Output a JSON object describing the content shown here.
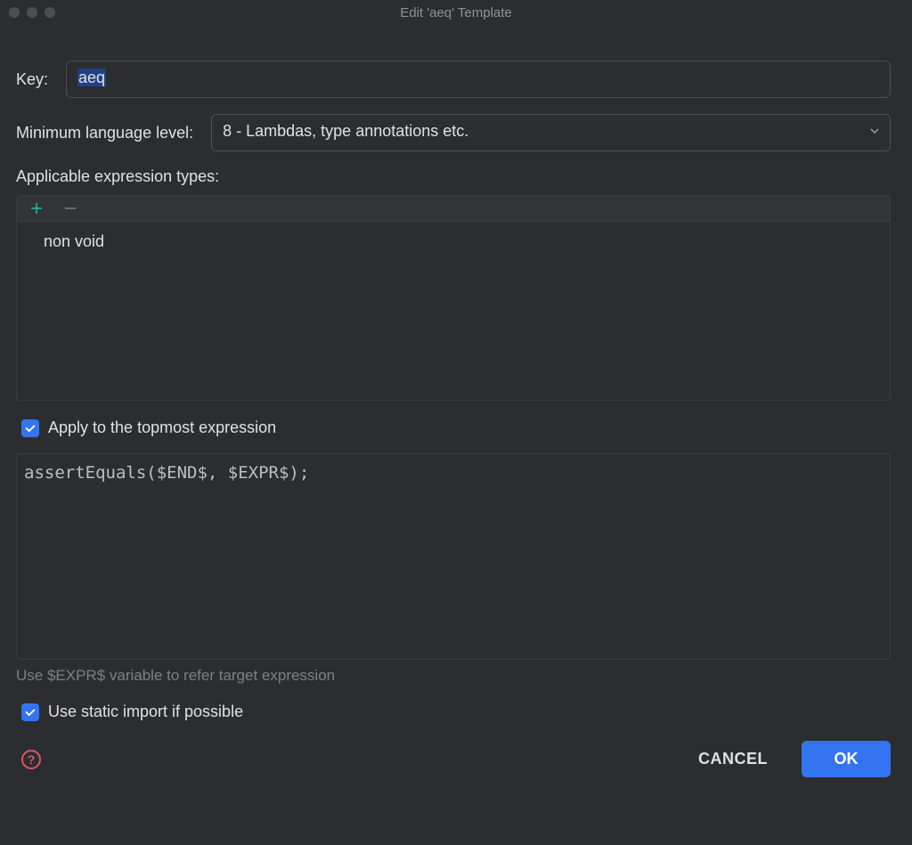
{
  "window": {
    "title": "Edit 'aeq' Template"
  },
  "form": {
    "key_label": "Key:",
    "key_value": "aeq",
    "lang_level_label": "Minimum language level:",
    "lang_level_value": "8 - Lambdas, type annotations etc."
  },
  "types": {
    "label": "Applicable expression types:",
    "items": [
      "non void"
    ]
  },
  "options": {
    "topmost_label": "Apply to the topmost expression",
    "topmost_checked": true,
    "static_import_label": "Use static import if possible",
    "static_import_checked": true
  },
  "editor": {
    "code": "assertEquals($END$, $EXPR$);",
    "hint": "Use $EXPR$ variable to refer target expression"
  },
  "footer": {
    "help": "?",
    "cancel": "CANCEL",
    "ok": "OK"
  }
}
